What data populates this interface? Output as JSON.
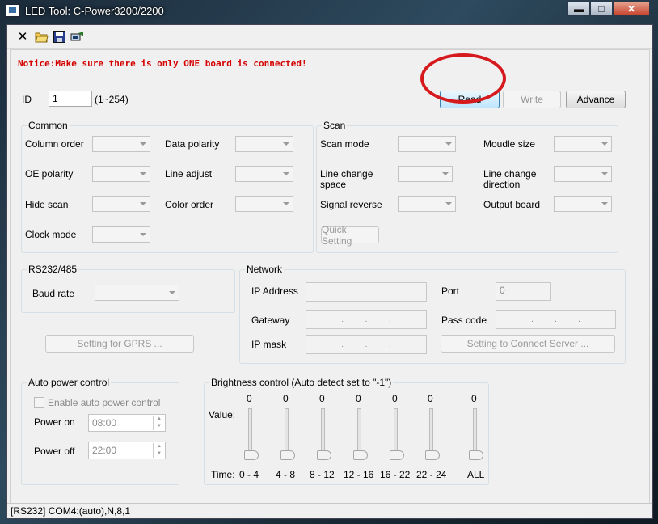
{
  "window": {
    "title": "LED Tool: C-Power3200/2200",
    "minimize": "▬",
    "maximize": "□",
    "close": "✕"
  },
  "toolbar": {
    "icons": [
      "close-icon",
      "open-folder-icon",
      "save-icon",
      "connection-icon"
    ]
  },
  "notice": "Notice:Make sure there is only ONE board is connected!",
  "id": {
    "label": "ID",
    "value": "1",
    "range": "(1~254)"
  },
  "actions": {
    "read": "Read",
    "write": "Write",
    "advance": "Advance"
  },
  "common": {
    "title": "Common",
    "column_order": "Column order",
    "data_polarity": "Data polarity",
    "oe_polarity": "OE polarity",
    "line_adjust": "Line adjust",
    "hide_scan": "Hide scan",
    "color_order": "Color order",
    "clock_mode": "Clock mode"
  },
  "scan": {
    "title": "Scan",
    "scan_mode": "Scan mode",
    "module_size": "Moudle size",
    "line_change_space": "Line change space",
    "line_change_direction": "Line change direction",
    "signal_reverse": "Signal reverse",
    "output_board": "Output board",
    "quick_setting": "Quick Setting"
  },
  "rs232": {
    "title": "RS232/485",
    "baud_rate": "Baud rate",
    "gprs_button": "Setting for GPRS ..."
  },
  "network": {
    "title": "Network",
    "ip_address": "IP Address",
    "port": "Port",
    "port_value": "0",
    "gateway": "Gateway",
    "pass_code": "Pass code",
    "ip_mask": "IP mask",
    "connect_button": "Setting to Connect Server ..."
  },
  "auto_power": {
    "title": "Auto power control",
    "enable": "Enable auto power control",
    "power_on": "Power on",
    "power_on_value": "08:00",
    "power_off": "Power off",
    "power_off_value": "22:00"
  },
  "brightness": {
    "title": "Brightness control (Auto detect set to \"-1\")",
    "value_label": "Value:",
    "time_label": "Time:",
    "values": [
      "0",
      "0",
      "0",
      "0",
      "0",
      "0",
      "0"
    ],
    "times": [
      "0 - 4",
      "4 - 8",
      "8 - 12",
      "12 - 16",
      "16 - 22",
      "22 - 24",
      "ALL"
    ]
  },
  "statusbar": "[RS232] COM4:(auto),N,8,1",
  "colors": {
    "notice": "#d40000",
    "annotation_circle": "#d6191d",
    "read_button": "#bee6fd"
  }
}
